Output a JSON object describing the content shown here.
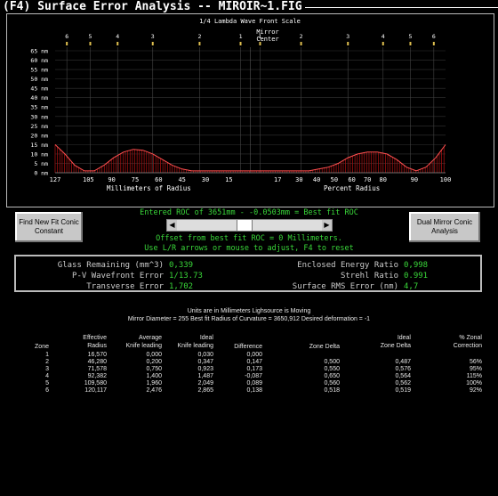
{
  "window": {
    "title": "(F4) Surface Error Analysis -- MIROIR~1.FIG"
  },
  "chart_data": {
    "type": "line",
    "title": "1/4 Lambda Wave Front Scale",
    "ylabel": "nm",
    "y_ticks": [
      "65 nm",
      "60 nm",
      "55 nm",
      "50 nm",
      "45 nm",
      "40 nm",
      "35 nm",
      "30 nm",
      "25 nm",
      "20 nm",
      "15 nm",
      "10 nm",
      "5 nm",
      "0 nm"
    ],
    "ylim": [
      0,
      65
    ],
    "x_ticks_left": [
      "127",
      "105",
      "90",
      "75",
      "60",
      "45",
      "30",
      "15"
    ],
    "x_ticks_right": [
      "17",
      "30",
      "40",
      "50",
      "60",
      "70",
      "80",
      "90",
      "100"
    ],
    "xlabel_left": "Millimeters of Radius",
    "xlabel_right": "Percent Radius",
    "center_labels": [
      "Mirror",
      "Center"
    ],
    "zone_markers": [
      "6",
      "5",
      "4",
      "3",
      "2",
      "1",
      "1",
      "2",
      "3",
      "4",
      "5",
      "6"
    ],
    "series": [
      {
        "values_x_percent": [
          -100,
          -95,
          -90,
          -85,
          -80,
          -75,
          -70,
          -65,
          -60,
          -55,
          -50,
          -45,
          -40,
          -35,
          -30,
          -25,
          -20,
          -15,
          -10,
          -5,
          0,
          5,
          10,
          15,
          20,
          25,
          30,
          35,
          40,
          45,
          50,
          55,
          60,
          65,
          70,
          75,
          80,
          85,
          90,
          95,
          100
        ],
        "values_nm": [
          15,
          10,
          4,
          1,
          1,
          4,
          8,
          11,
          12.5,
          12,
          10,
          7,
          4,
          2,
          1,
          1,
          1,
          1,
          1,
          1,
          1,
          1,
          1,
          1,
          1,
          1,
          1,
          2,
          3,
          5,
          8,
          10,
          11,
          11,
          10,
          7,
          3,
          1,
          3,
          8,
          15
        ]
      }
    ]
  },
  "buttons": {
    "find_best_label": "Find New Fit Conic Constant",
    "dual_mirror_label": "Dual Mirror Conic Analysis"
  },
  "fit_info": {
    "entered_line": "Entered ROC of 3651mm - -0.0503mm = Best fit ROC",
    "offset_line": "Offset from best fit ROC = 0 Millimeters.",
    "instructions_line": "Use L/R arrows or mouse to adjust, F4 to reset"
  },
  "stats": {
    "glass_removal": {
      "label": "Glass Remaining (mm^3)",
      "value": "0,339"
    },
    "pv_error": {
      "label": "P-V Wavefront Error",
      "value": "1/13.73"
    },
    "transverse": {
      "label": "Transverse Error",
      "value": "1,702"
    },
    "energy_ratio": {
      "label": "Enclosed Energy Ratio",
      "value": "0,998"
    },
    "strehl_ratio": {
      "label": "Strehl Ratio",
      "value": "0.991"
    },
    "rms_error": {
      "label": "Surface RMS Error (nm)",
      "value": "4,7"
    }
  },
  "report": {
    "line1": "Units are in Millimeters  Lighsource is Moving",
    "line2": "Mirror Diameter = 255    Best fit Radius of Curvature = 3650,912    Desired deformation = -1",
    "headers": [
      [
        "Zone"
      ],
      [
        "Effective",
        "Radius"
      ],
      [
        "Average",
        "Knife leading"
      ],
      [
        "Ideal",
        "Knife leading"
      ],
      [
        "Difference"
      ],
      [
        "Zone Delta"
      ],
      [
        "Ideal",
        "Zone Delta"
      ],
      [
        "% Zonal",
        "Correction"
      ]
    ],
    "rows": [
      [
        "1",
        "16,570",
        "0,000",
        "0,030",
        "0,000",
        "",
        "",
        ""
      ],
      [
        "2",
        "46,280",
        "0,200",
        "0,347",
        "0,147",
        "0,500",
        "0,487",
        "56%"
      ],
      [
        "3",
        "71,578",
        "0,750",
        "0,923",
        "0,173",
        "0,550",
        "0,576",
        "95%"
      ],
      [
        "4",
        "92,382",
        "1,400",
        "1,487",
        "-0,087",
        "0,650",
        "0,564",
        "115%"
      ],
      [
        "5",
        "109,580",
        "1,960",
        "2,049",
        "0,089",
        "0,560",
        "0,562",
        "100%"
      ],
      [
        "6",
        "120,117",
        "2,476",
        "2,865",
        "0,138",
        "0,518",
        "0,519",
        "92%"
      ]
    ]
  }
}
